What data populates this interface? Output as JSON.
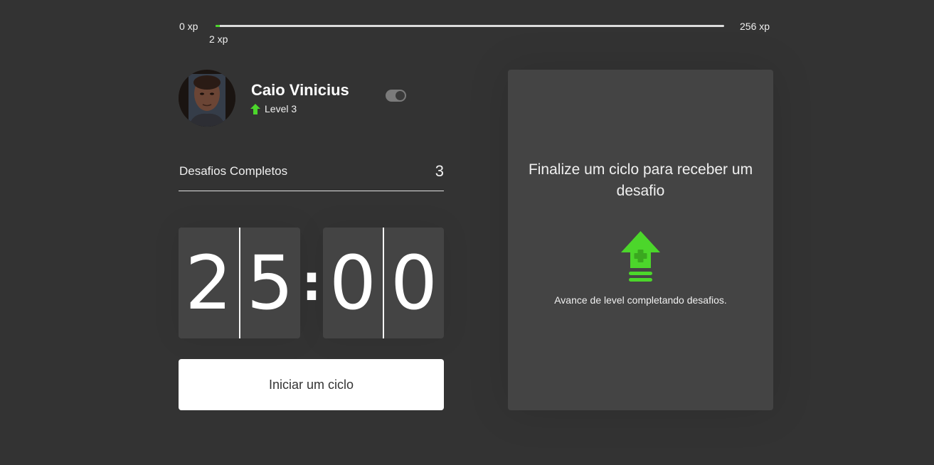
{
  "xp": {
    "min_label": "0 xp",
    "max_label": "256 xp",
    "current_label": "2 xp",
    "current": 2,
    "max": 256,
    "progress_fraction": 0.008,
    "accent_color": "#4cd62b"
  },
  "profile": {
    "name": "Caio Vinicius",
    "level_label": "Level 3",
    "level_icon": "level-up-arrow-icon",
    "theme_toggle_on": true
  },
  "challenges": {
    "label": "Desafios Completos",
    "count": "3"
  },
  "countdown": {
    "minutes_left": "2",
    "minutes_right": "5",
    "separator": ":",
    "seconds_left": "0",
    "seconds_right": "0"
  },
  "start_button": {
    "label": "Iniciar um ciclo"
  },
  "challenge_panel": {
    "title": "Finalize um ciclo para receber um desafio",
    "icon": "level-up-icon",
    "description": "Avance de level completando desafios."
  },
  "colors": {
    "background": "#333333",
    "card": "#444444",
    "green": "#4cd62b",
    "white": "#ffffff"
  }
}
